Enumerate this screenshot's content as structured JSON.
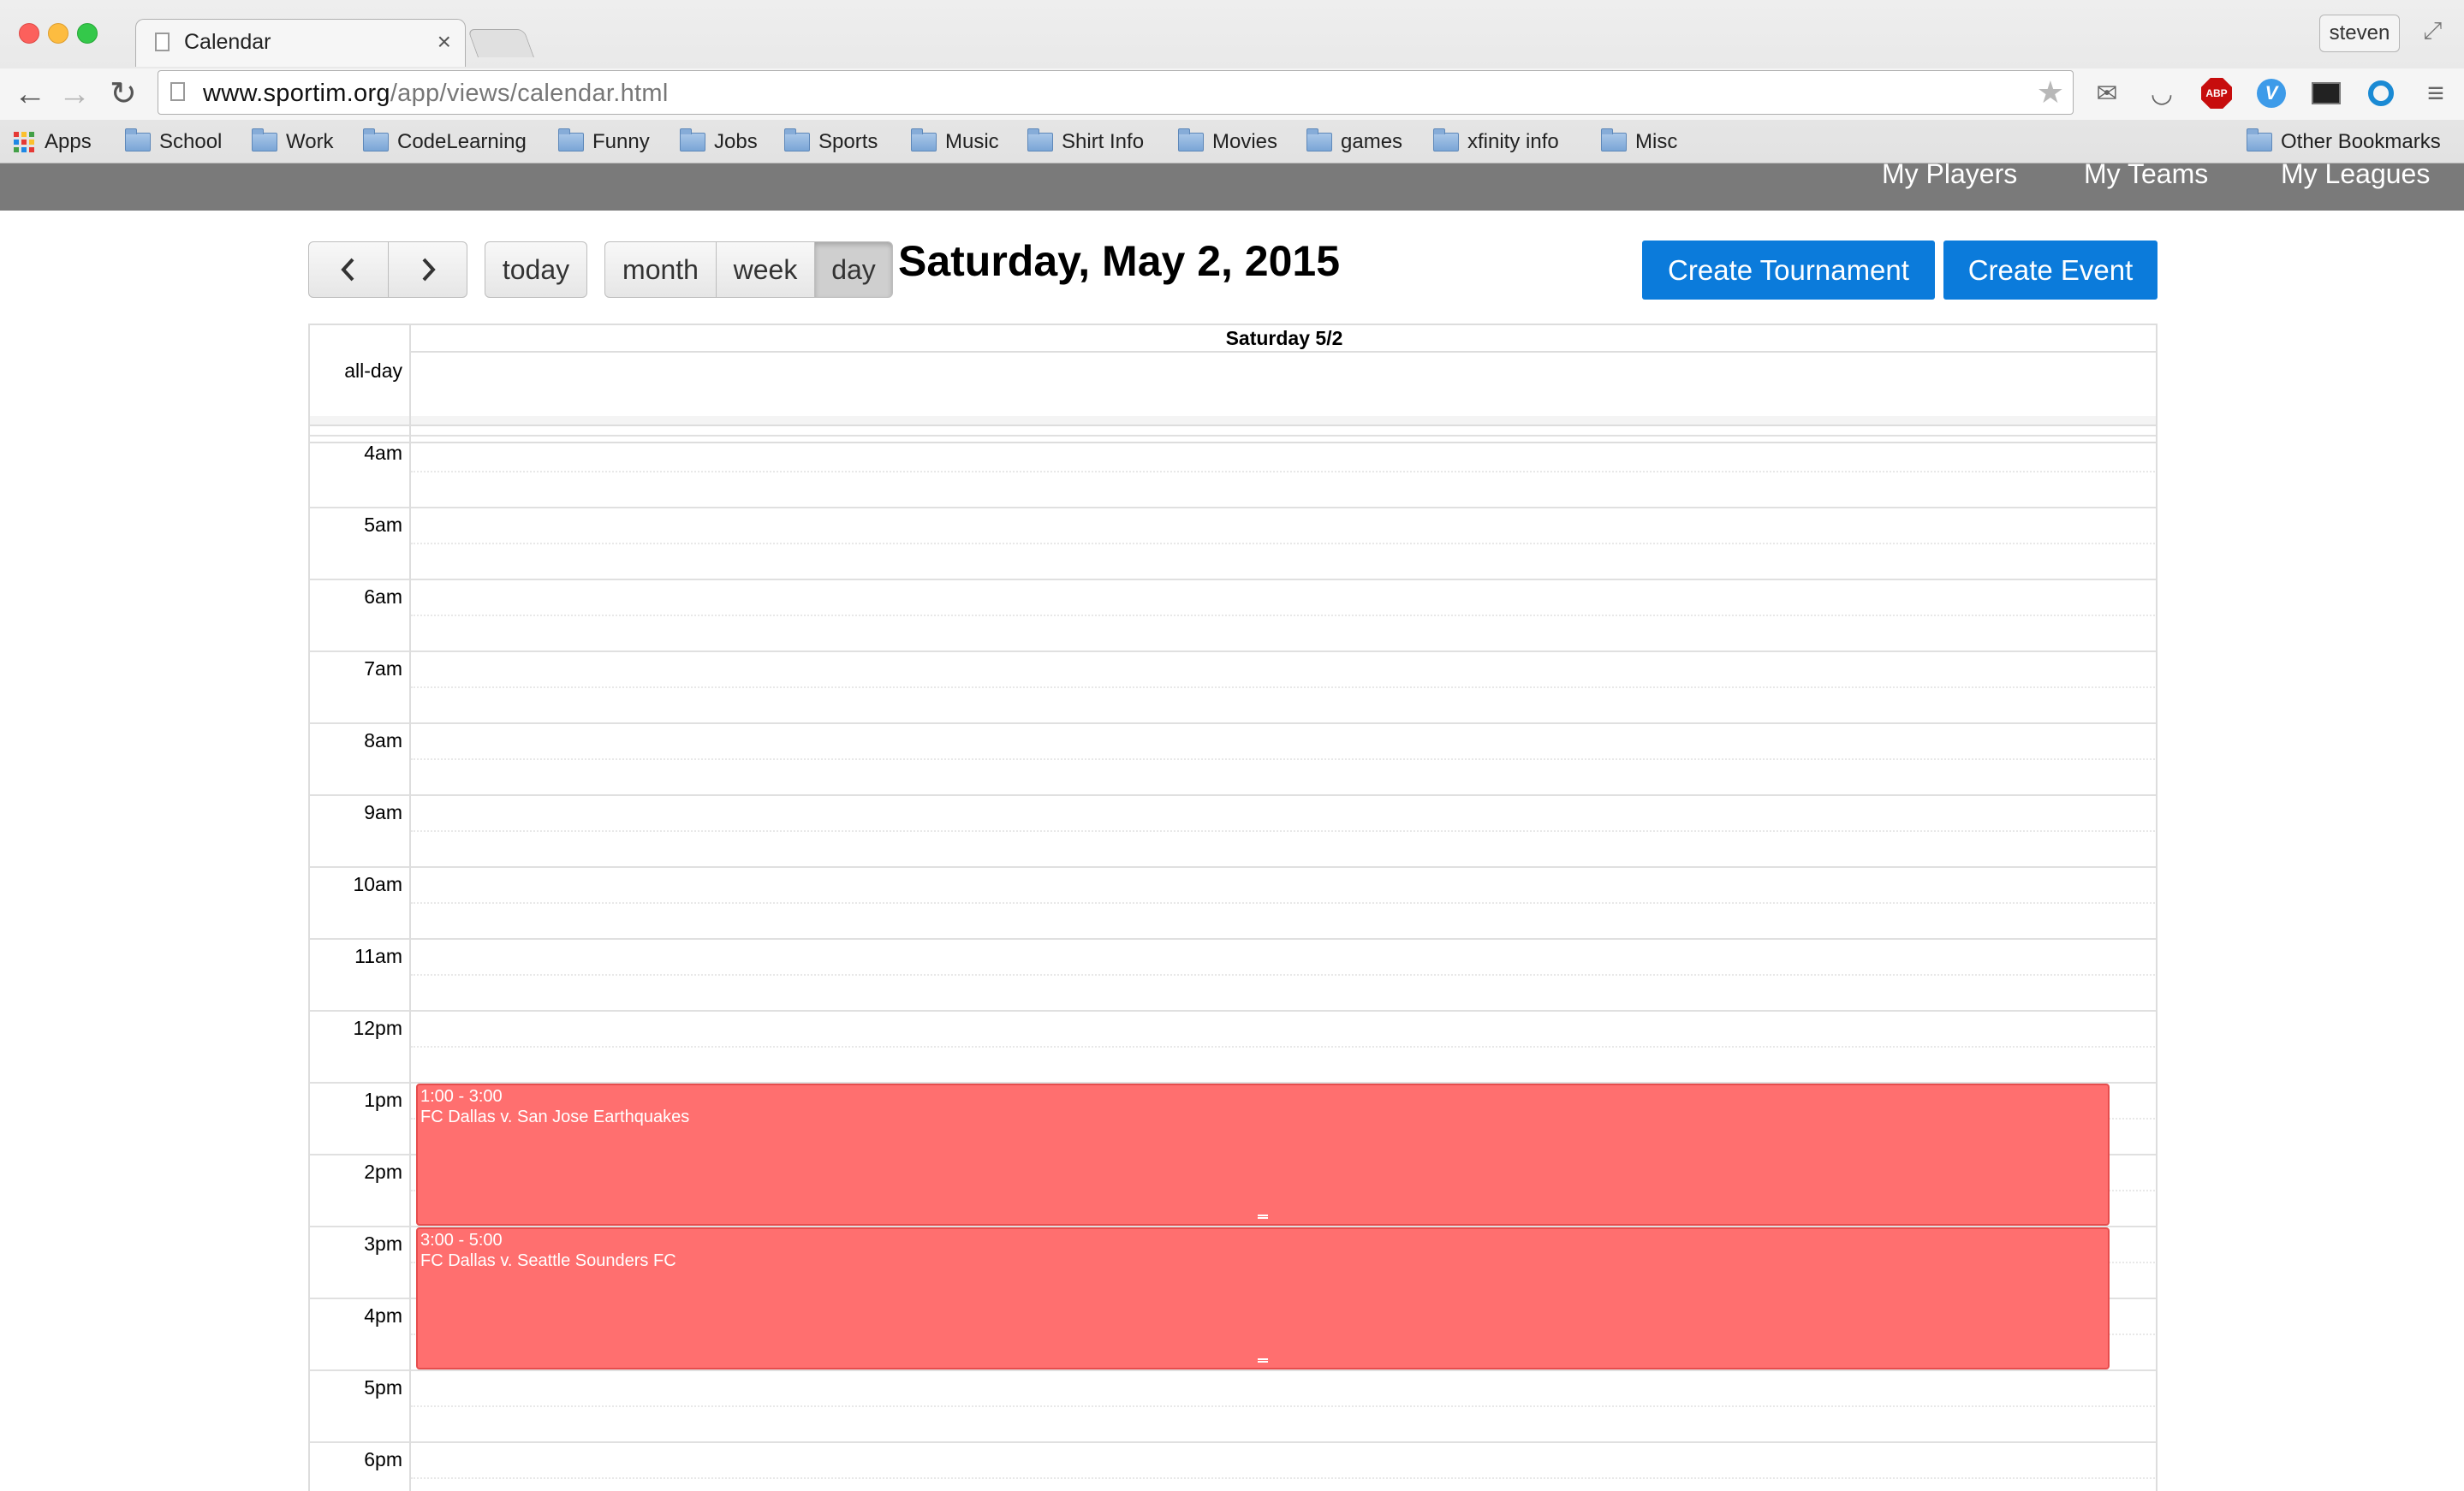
{
  "browser": {
    "tab_title": "Calendar",
    "tab_close": "×",
    "profile_name": "steven",
    "url_host": "www.sportim.org",
    "url_path": "/app/views/calendar.html",
    "bookmarks": [
      "Apps",
      "School",
      "Work",
      "CodeLearning",
      "Funny",
      "Jobs",
      "Sports",
      "Music",
      "Shirt Info",
      "Movies",
      "games",
      "xfinity info",
      "Misc"
    ],
    "other_bookmarks": "Other Bookmarks",
    "extensions": [
      "mail-icon",
      "cup-icon",
      "adblock-plus-icon",
      "v-extension-icon",
      "terminal-icon",
      "ring-extension-icon",
      "menu-icon"
    ],
    "abp_label": "ABP",
    "v_label": "V"
  },
  "nav": {
    "my_players": "My Players",
    "my_teams": "My Teams",
    "my_leagues": "My Leagues"
  },
  "toolbar": {
    "prev_icon": "‹",
    "next_icon": "›",
    "today": "today",
    "month": "month",
    "week": "week",
    "day": "day",
    "active_view": "day",
    "title": "Saturday, May 2, 2015",
    "create_tournament": "Create Tournament",
    "create_event": "Create Event"
  },
  "calendar": {
    "day_header": "Saturday 5/2",
    "all_day_label": "all-day",
    "hours": [
      "4am",
      "5am",
      "6am",
      "7am",
      "8am",
      "9am",
      "10am",
      "11am",
      "12pm",
      "1pm",
      "2pm",
      "3pm",
      "4pm",
      "5pm",
      "6pm"
    ],
    "events": [
      {
        "time": "1:00 - 3:00",
        "title": "FC Dallas v. San Jose Earthquakes",
        "start": "1pm",
        "end": "3pm"
      },
      {
        "time": "3:00 - 5:00",
        "title": "FC Dallas v. Seattle Sounders FC",
        "start": "3pm",
        "end": "5pm"
      }
    ],
    "event_color": "#ff6f6f"
  }
}
